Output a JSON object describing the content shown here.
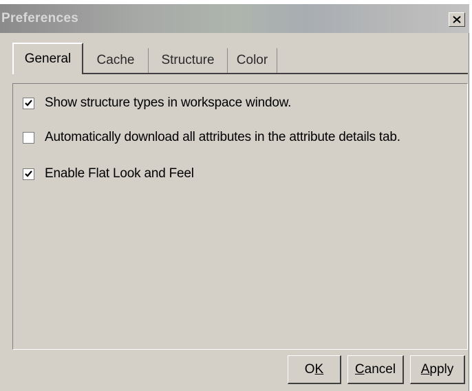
{
  "window": {
    "title": "Preferences",
    "close_icon": "close-icon"
  },
  "tabs": [
    {
      "label": "General",
      "selected": true
    },
    {
      "label": "Cache",
      "selected": false
    },
    {
      "label": "Structure",
      "selected": false
    },
    {
      "label": "Color",
      "selected": false
    }
  ],
  "options": [
    {
      "label": "Show structure types in workspace window.",
      "checked": true
    },
    {
      "label": "Automatically download all attributes in the attribute details tab.",
      "checked": false
    },
    {
      "label": "Enable Flat Look and Feel",
      "checked": true
    }
  ],
  "buttons": {
    "ok": {
      "label": "OK",
      "mnemonic": "K"
    },
    "cancel": {
      "label": "Cancel",
      "mnemonic": "C"
    },
    "apply": {
      "label": "Apply",
      "mnemonic": "A"
    }
  }
}
